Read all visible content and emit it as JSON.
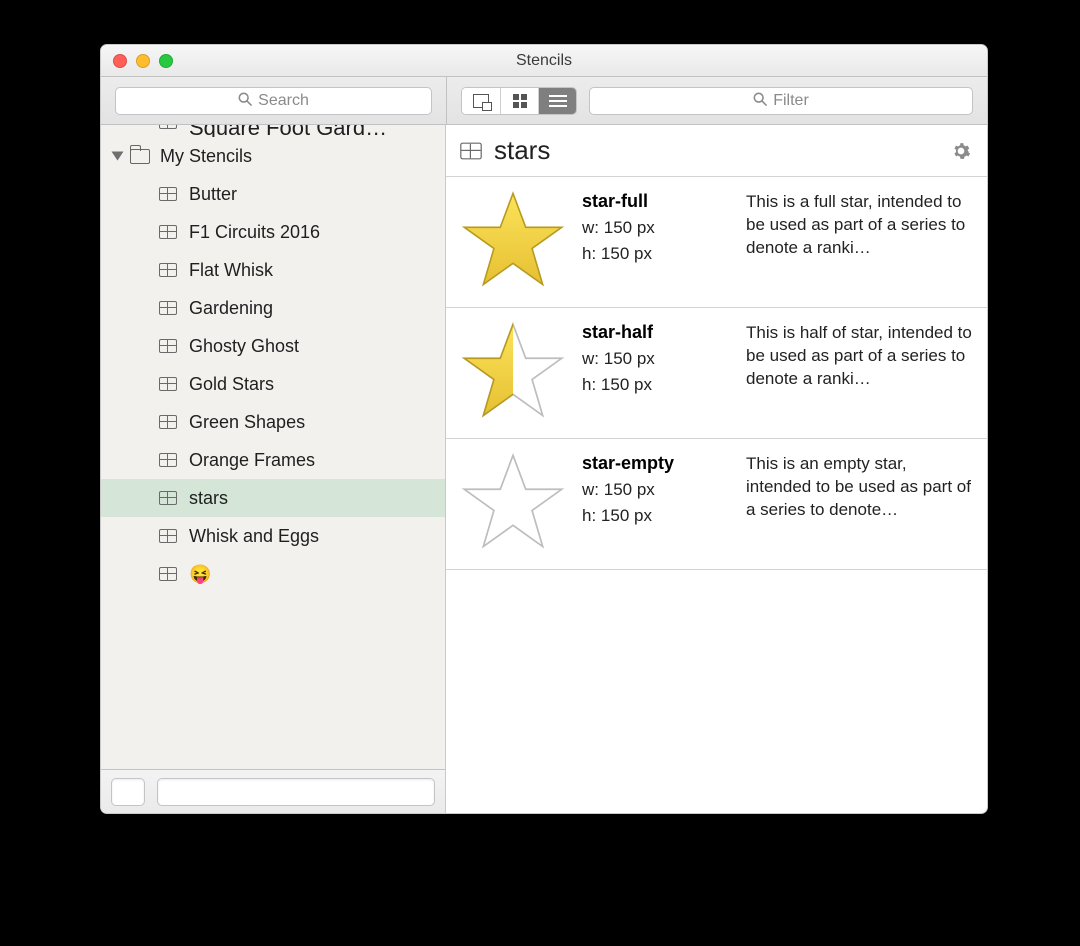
{
  "window": {
    "title": "Stencils"
  },
  "toolbar": {
    "search_placeholder": "Search",
    "filter_placeholder": "Filter",
    "view_modes": {
      "tiles": "tiles",
      "grid": "grid",
      "list": "list"
    },
    "active_view": "list"
  },
  "sidebar": {
    "partial_above": "Square Foot Gard…",
    "group_label": "My Stencils",
    "items": [
      {
        "label": "Butter"
      },
      {
        "label": "F1 Circuits 2016"
      },
      {
        "label": "Flat Whisk"
      },
      {
        "label": "Gardening"
      },
      {
        "label": "Ghosty Ghost"
      },
      {
        "label": "Gold Stars"
      },
      {
        "label": "Green Shapes"
      },
      {
        "label": "Orange Frames"
      },
      {
        "label": "stars"
      },
      {
        "label": "Whisk and Eggs"
      },
      {
        "label": "😝"
      }
    ],
    "selected_index": 8
  },
  "detail": {
    "title": "stars",
    "w_label_prefix": "w: ",
    "h_label_prefix": "h: ",
    "px_suffix": " px",
    "items": [
      {
        "name": "star-full",
        "w": "150",
        "h": "150",
        "desc": "This is a full star, intended to be used as part of a series to denote a ranki…",
        "thumb": "full"
      },
      {
        "name": "star-half",
        "w": "150",
        "h": "150",
        "desc": "This is half of star, intended to be used as part of a series to denote a ranki…",
        "thumb": "half"
      },
      {
        "name": "star-empty",
        "w": "150",
        "h": "150",
        "desc": "This is an empty star, intended to be used as part of a series to denote…",
        "thumb": "empty"
      }
    ]
  }
}
